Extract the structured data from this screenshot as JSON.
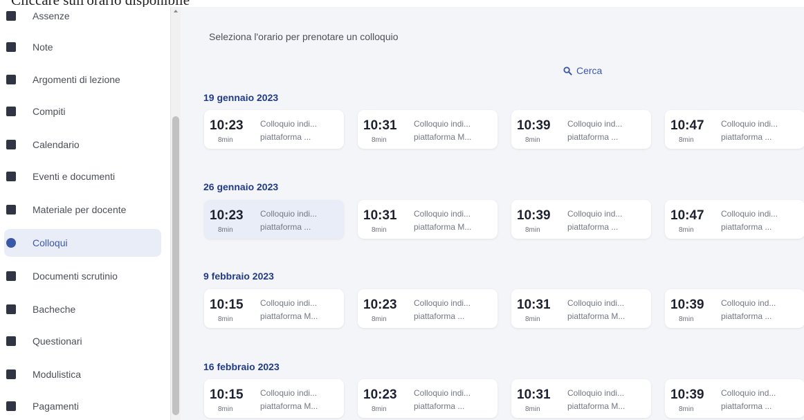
{
  "instruction": "Cliccare sull'orario disponibile",
  "sidebar": {
    "items": [
      {
        "label": "Assenze",
        "icon": "person-check-icon",
        "active": false
      },
      {
        "label": "Note",
        "icon": "note-icon",
        "active": false
      },
      {
        "label": "Argomenti di lezione",
        "icon": "book-icon",
        "active": false
      },
      {
        "label": "Compiti",
        "icon": "homework-icon",
        "active": false
      },
      {
        "label": "Calendario",
        "icon": "calendar-icon",
        "active": false
      },
      {
        "label": "Eventi e documenti",
        "icon": "folder-icon",
        "active": false
      },
      {
        "label": "Materiale per docente",
        "icon": "material-icon",
        "active": false
      },
      {
        "label": "Colloqui",
        "icon": "chat-icon",
        "active": true
      },
      {
        "label": "Documenti scrutinio",
        "icon": "document-icon",
        "active": false
      },
      {
        "label": "Bacheche",
        "icon": "board-icon",
        "active": false
      },
      {
        "label": "Questionari",
        "icon": "question-icon",
        "active": false
      },
      {
        "label": "Modulistica",
        "icon": "form-icon",
        "active": false
      },
      {
        "label": "Pagamenti",
        "icon": "payment-icon",
        "active": false
      }
    ]
  },
  "main": {
    "subtitle": "Seleziona l'orario per prenotare un colloquio",
    "search_label": "Cerca",
    "days": [
      {
        "date": "19 gennaio 2023",
        "slots": [
          {
            "time": "10:23",
            "duration": "8min",
            "line1": "Colloquio indi...",
            "line2": "piattaforma ..."
          },
          {
            "time": "10:31",
            "duration": "8min",
            "line1": "Colloquio indi...",
            "line2": "piattaforma M..."
          },
          {
            "time": "10:39",
            "duration": "8min",
            "line1": "Colloquio ind...",
            "line2": "piattaforma ..."
          },
          {
            "time": "10:47",
            "duration": "8min",
            "line1": "Colloquio indi...",
            "line2": "piattaforma ..."
          }
        ]
      },
      {
        "date": "26 gennaio 2023",
        "slots": [
          {
            "time": "10:23",
            "duration": "8min",
            "line1": "Colloquio indi...",
            "line2": "piattaforma ...",
            "highlight": true
          },
          {
            "time": "10:31",
            "duration": "8min",
            "line1": "Colloquio indi...",
            "line2": "piattaforma M..."
          },
          {
            "time": "10:39",
            "duration": "8min",
            "line1": "Colloquio ind...",
            "line2": "piattaforma ..."
          },
          {
            "time": "10:47",
            "duration": "8min",
            "line1": "Colloquio indi...",
            "line2": "piattaforma ..."
          }
        ]
      },
      {
        "date": "9 febbraio 2023",
        "slots": [
          {
            "time": "10:15",
            "duration": "8min",
            "line1": "Colloquio indi...",
            "line2": "piattaforma M..."
          },
          {
            "time": "10:23",
            "duration": "8min",
            "line1": "Colloquio indi...",
            "line2": "piattaforma ..."
          },
          {
            "time": "10:31",
            "duration": "8min",
            "line1": "Colloquio indi...",
            "line2": "piattaforma M..."
          },
          {
            "time": "10:39",
            "duration": "8min",
            "line1": "Colloquio ind...",
            "line2": "piattaforma ..."
          }
        ]
      },
      {
        "date": "16 febbraio 2023",
        "slots": [
          {
            "time": "10:15",
            "duration": "8min",
            "line1": "Colloquio indi...",
            "line2": "piattaforma M..."
          },
          {
            "time": "10:23",
            "duration": "8min",
            "line1": "Colloquio indi...",
            "line2": "piattaforma ..."
          },
          {
            "time": "10:31",
            "duration": "8min",
            "line1": "Colloquio indi...",
            "line2": "piattaforma M..."
          },
          {
            "time": "10:39",
            "duration": "8min",
            "line1": "Colloquio ind...",
            "line2": "piattaforma ..."
          }
        ]
      }
    ]
  },
  "colors": {
    "accent": "#3b57a8",
    "date_heading": "#1f3a8a",
    "main_bg": "#f4f5f9",
    "active_bg": "#e9edf7"
  }
}
